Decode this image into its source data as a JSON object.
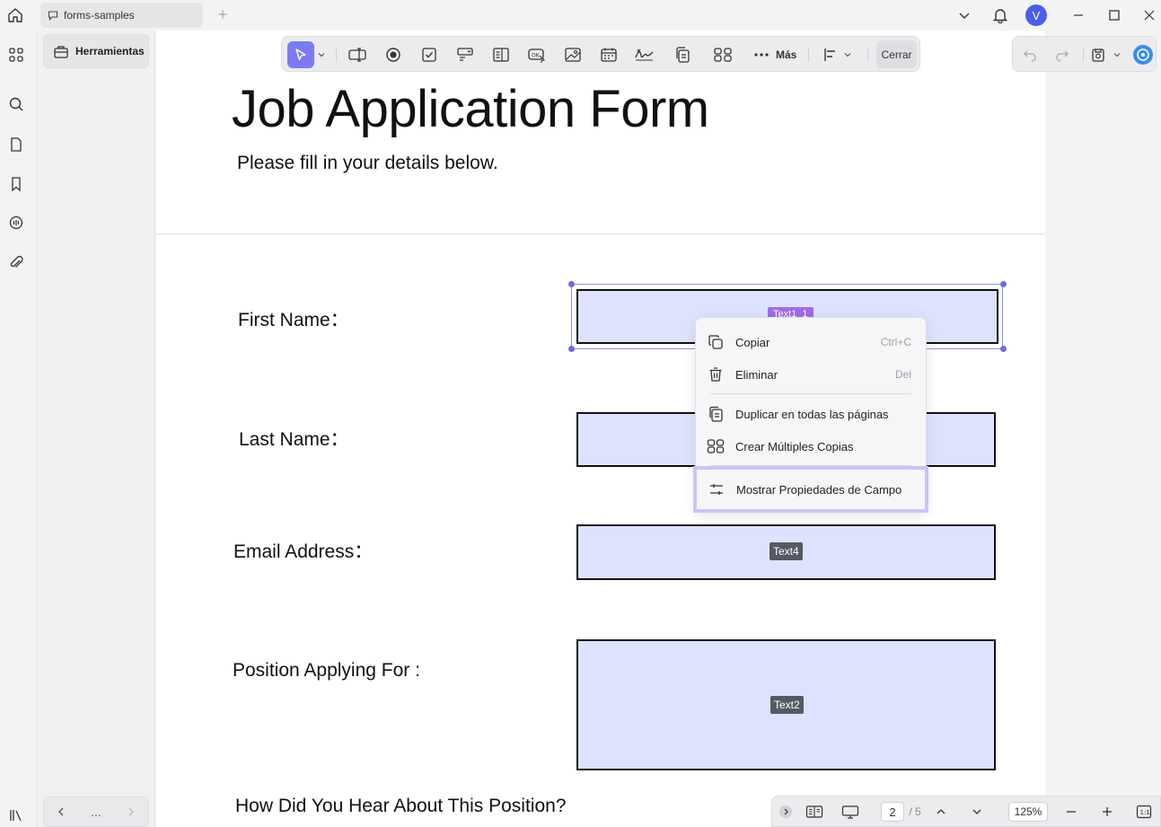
{
  "window": {
    "tab_title": "forms-samples",
    "new_tab": "+",
    "avatar_initial": "V",
    "accent_color": "#7c7af2"
  },
  "sidepanel": {
    "tools_label": "Herramientas",
    "pager_more": "..."
  },
  "toolbar": {
    "more_label": "Más",
    "close_label": "Cerrar"
  },
  "document": {
    "title": "Job Application Form",
    "subtitle": "Please fill in your details below.",
    "labels": {
      "first_name": "First Name：",
      "last_name": "Last Name：",
      "email": "Email Address：",
      "position": "Position Applying For :",
      "hear_about": "How Did You Hear About This Position?"
    },
    "field_tags": {
      "first_name": "Text1_1",
      "email": "Text4",
      "position": "Text2"
    },
    "field_fill_color": "#dde3ff"
  },
  "context_menu": {
    "items": [
      {
        "label": "Copiar",
        "shortcut": "Ctrl+C"
      },
      {
        "label": "Eliminar",
        "shortcut": "Del"
      },
      {
        "label": "Duplicar en todas las páginas",
        "shortcut": ""
      },
      {
        "label": "Crear Múltiples Copias",
        "shortcut": ""
      },
      {
        "label": "Mostrar Propiedades de Campo",
        "shortcut": ""
      }
    ],
    "highlight_color": "#c9c4f6"
  },
  "bottombar": {
    "current_page": "2",
    "page_total": "/ 5",
    "zoom": "125%",
    "fit_label": "1:1"
  }
}
